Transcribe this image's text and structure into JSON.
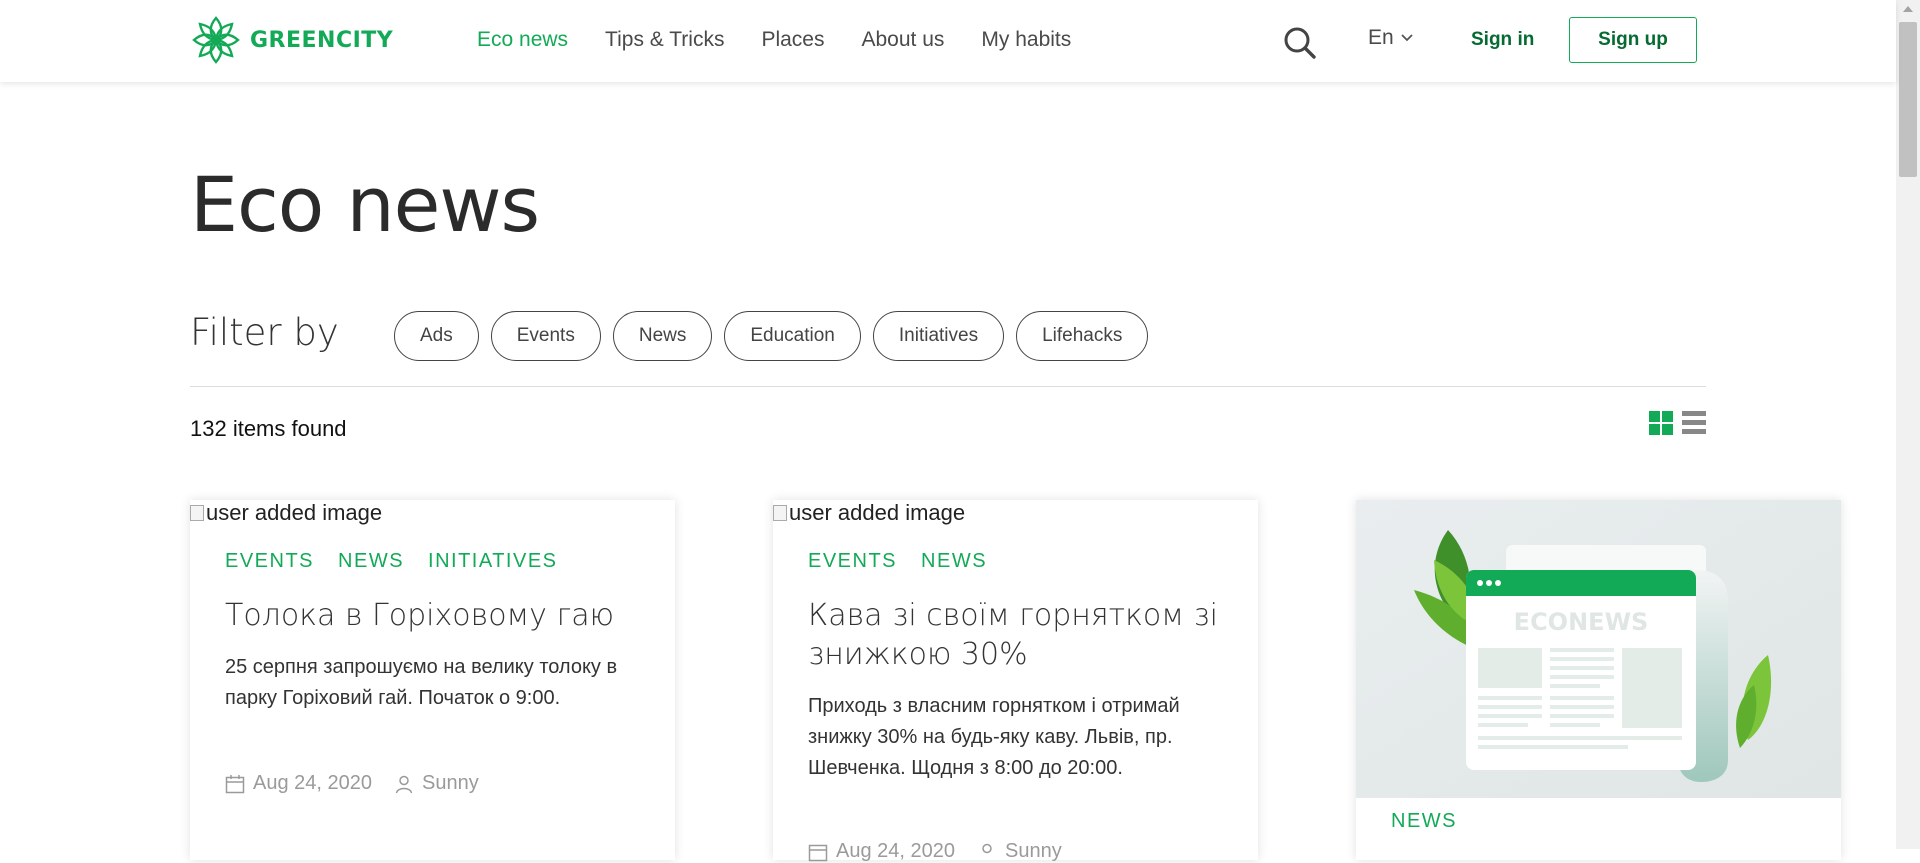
{
  "header": {
    "logo_text": "GREENCITY",
    "nav": [
      {
        "label": "Eco news",
        "active": true
      },
      {
        "label": "Tips & Tricks",
        "active": false
      },
      {
        "label": "Places",
        "active": false
      },
      {
        "label": "About us",
        "active": false
      },
      {
        "label": "My habits",
        "active": false
      }
    ],
    "search_icon": "search-icon",
    "language": "En",
    "sign_in": "Sign in",
    "sign_up": "Sign up"
  },
  "main": {
    "title": "Eco news",
    "filter_label": "Filter by",
    "filters": [
      "Ads",
      "Events",
      "News",
      "Education",
      "Initiatives",
      "Lifehacks"
    ],
    "items_found": "132 items found",
    "view_icons": [
      "grid-view-icon",
      "list-view-icon"
    ]
  },
  "cards": [
    {
      "image_alt": "user added image",
      "tags": [
        "EVENTS",
        "NEWS",
        "INITIATIVES"
      ],
      "title": "Толока в Горіховому гаю",
      "text": " 25 серпня запрошуємо на велику толоку в парку Горіховий гай. Початок о 9:00.",
      "date": "Aug 24, 2020",
      "author": "Sunny"
    },
    {
      "image_alt": "user added image",
      "tags": [
        "EVENTS",
        "NEWS"
      ],
      "title": "Кава зі своїм горнятком зі знижкою 30%",
      "text": " Приходь з власним горнятком і отримай знижку 30% на будь-яку каву. Львів, пр. Шевченка. Щодня з 8:00 до 20:00.",
      "date": "Aug 24, 2020",
      "author": "Sunny"
    },
    {
      "image_label": "ECONEWS",
      "tags": [
        "NEWS"
      ]
    }
  ],
  "colors": {
    "brand_green": "#13aa57",
    "dark_green": "#056b33",
    "text": "#333333",
    "muted": "#9a9a9a"
  }
}
